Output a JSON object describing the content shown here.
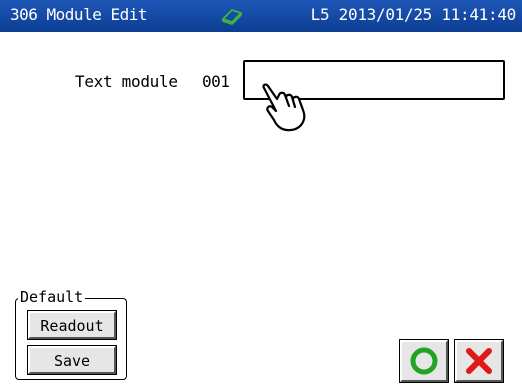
{
  "titlebar": {
    "title": "306 Module Edit",
    "status_icon": "eraser-icon",
    "status_icon_color": "#3fb43f",
    "info": "L5 2013/01/25 11:41:40",
    "background": "#1a4fae"
  },
  "form": {
    "label": "Text module",
    "number": "001",
    "input_value": "",
    "pointer_icon": "hand-pointer-icon"
  },
  "default_group": {
    "legend": "Default",
    "readout_label": "Readout",
    "save_label": "Save"
  },
  "actions": {
    "ok_icon": "circle-ok-icon",
    "ok_color": "#22a322",
    "cancel_icon": "x-cancel-icon",
    "cancel_color": "#e01818"
  }
}
